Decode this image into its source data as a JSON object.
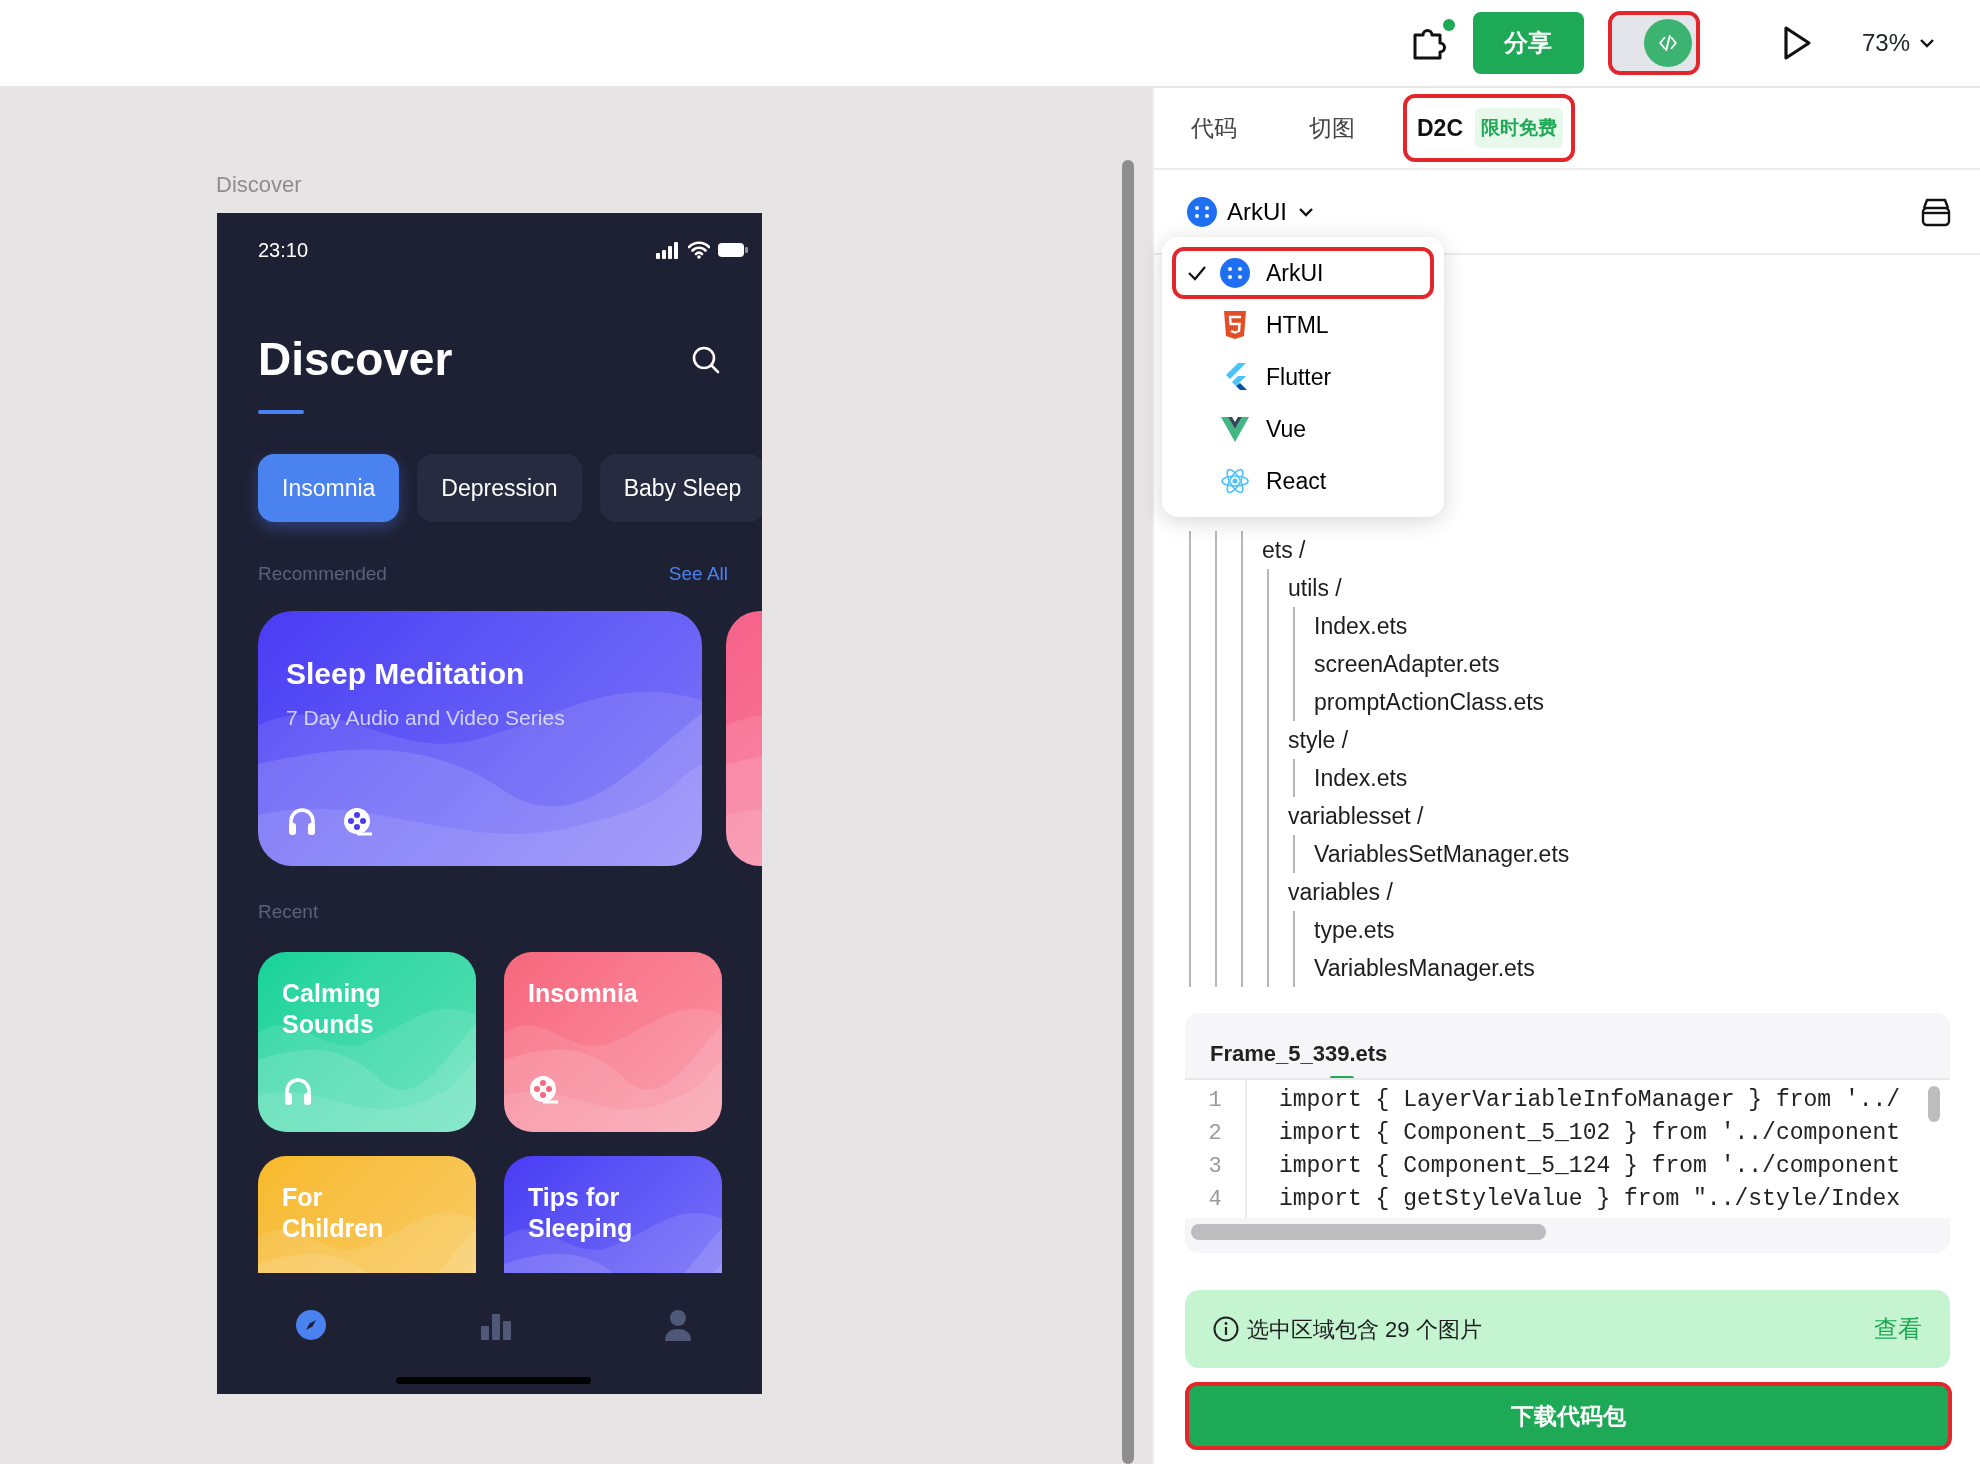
{
  "toolbar": {
    "plugin_badge": true,
    "share_button": "分享",
    "code_toggle": {
      "on": true,
      "highlighted": true
    },
    "zoom": "73%"
  },
  "canvas": {
    "frame_label": "Discover",
    "phone": {
      "time": "23:10",
      "title": "Discover",
      "chips": [
        {
          "label": "Insomnia",
          "selected": true
        },
        {
          "label": "Depression",
          "selected": false
        },
        {
          "label": "Baby Sleep",
          "selected": false
        }
      ],
      "recommended": {
        "heading": "Recommended",
        "link": "See All",
        "cards": [
          {
            "title": "Sleep Meditation",
            "subtitle": "7 Day Audio and Video Series",
            "audio": true,
            "video": true,
            "color": "#4a3bf4"
          },
          {
            "color": "#f7628a"
          }
        ]
      },
      "recent": {
        "heading": "Recent",
        "cards": [
          {
            "title": "Calming Sounds",
            "audio": true,
            "color": "#12d399"
          },
          {
            "title": "Insomnia",
            "video": true,
            "color": "#f7677e"
          },
          {
            "title": "For Children",
            "color": "#f7b92a"
          },
          {
            "title": "Tips for Sleeping",
            "color": "#4a3bf4"
          }
        ]
      },
      "bottom_nav": [
        {
          "kind": "discover",
          "selected": true
        },
        {
          "kind": "stats",
          "selected": false
        },
        {
          "kind": "profile",
          "selected": false
        }
      ]
    }
  },
  "panel": {
    "tabs": [
      {
        "label": "代码",
        "selected": false,
        "highlighted": false
      },
      {
        "label": "切图",
        "selected": false,
        "highlighted": false
      },
      {
        "label": "D2C",
        "badge": "限时免费",
        "selected": true,
        "highlighted": true
      }
    ],
    "language": {
      "current": "ArkUI",
      "expanded": true,
      "options": [
        {
          "label": "ArkUI",
          "kind": "harmony",
          "selected": true,
          "highlighted": true
        },
        {
          "label": "HTML",
          "kind": "html",
          "selected": false,
          "highlighted": false
        },
        {
          "label": "Flutter",
          "kind": "flutter",
          "selected": false,
          "highlighted": false
        },
        {
          "label": "Vue",
          "kind": "vue",
          "selected": false,
          "highlighted": false
        },
        {
          "label": "React",
          "kind": "react",
          "selected": false,
          "highlighted": false
        }
      ]
    },
    "file_tree": [
      {
        "label": "ets /",
        "children": [
          {
            "label": "utils /",
            "children": [
              {
                "label": "Index.ets"
              },
              {
                "label": "screenAdapter.ets"
              },
              {
                "label": "promptActionClass.ets"
              }
            ]
          },
          {
            "label": "style /",
            "children": [
              {
                "label": "Index.ets"
              }
            ]
          },
          {
            "label": "variablesset /",
            "children": [
              {
                "label": "VariablesSetManager.ets"
              }
            ]
          },
          {
            "label": "variables /",
            "children": [
              {
                "label": "type.ets"
              },
              {
                "label": "VariablesManager.ets"
              }
            ]
          }
        ]
      }
    ],
    "code_file": {
      "name": "Frame_5_339.ets",
      "lines": [
        {
          "number": "1",
          "text": "import { LayerVariableInfoManager } from '../"
        },
        {
          "number": "2",
          "text": "import { Component_5_102 } from '../component"
        },
        {
          "number": "3",
          "text": "import { Component_5_124 } from '../component"
        },
        {
          "number": "4",
          "text": "import { getStyleValue } from \"../style/Index"
        }
      ]
    },
    "notice": {
      "text": "选中区域包含 29 个图片",
      "link": "查看"
    },
    "download_button": {
      "label": "下载代码包",
      "highlighted": true
    }
  }
}
